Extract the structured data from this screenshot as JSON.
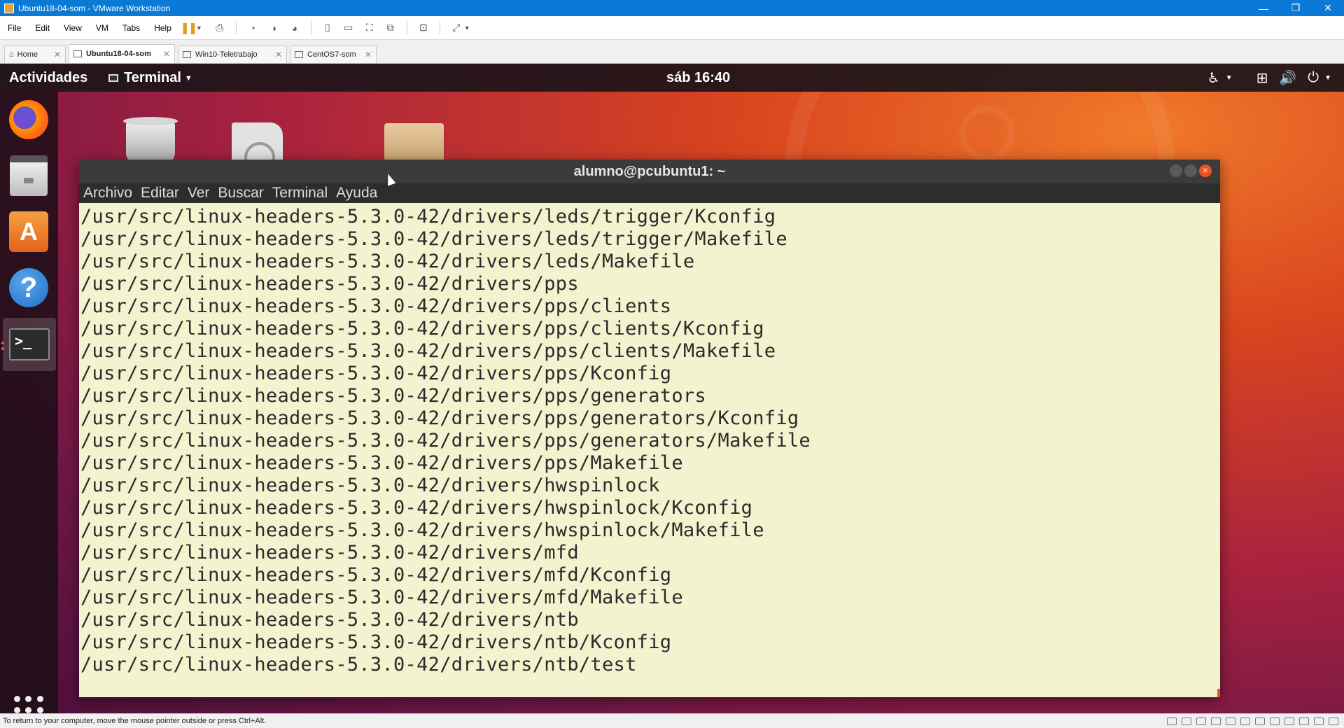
{
  "window": {
    "title": "Ubuntu18-04-som - VMware Workstation",
    "controls": {
      "minimize": "—",
      "restore": "❐",
      "close": "✕"
    }
  },
  "menubar": {
    "items": [
      "File",
      "Edit",
      "View",
      "VM",
      "Tabs",
      "Help"
    ]
  },
  "tabs": [
    {
      "label": "Home",
      "icon": "home-icon",
      "active": false
    },
    {
      "label": "Ubuntu18-04-som",
      "icon": "vm-icon",
      "active": true
    },
    {
      "label": "Win10-Teletrabajo",
      "icon": "vm-icon",
      "active": false
    },
    {
      "label": "CentOS7-som",
      "icon": "vm-icon",
      "active": false
    }
  ],
  "gnome": {
    "activities": "Actividades",
    "app_menu": "Terminal",
    "clock": "sáb 16:40"
  },
  "terminal": {
    "title": "alumno@pcubuntu1: ~",
    "menu": [
      "Archivo",
      "Editar",
      "Ver",
      "Buscar",
      "Terminal",
      "Ayuda"
    ],
    "lines": [
      "/usr/src/linux-headers-5.3.0-42/drivers/leds/trigger/Kconfig",
      "/usr/src/linux-headers-5.3.0-42/drivers/leds/trigger/Makefile",
      "/usr/src/linux-headers-5.3.0-42/drivers/leds/Makefile",
      "/usr/src/linux-headers-5.3.0-42/drivers/pps",
      "/usr/src/linux-headers-5.3.0-42/drivers/pps/clients",
      "/usr/src/linux-headers-5.3.0-42/drivers/pps/clients/Kconfig",
      "/usr/src/linux-headers-5.3.0-42/drivers/pps/clients/Makefile",
      "/usr/src/linux-headers-5.3.0-42/drivers/pps/Kconfig",
      "/usr/src/linux-headers-5.3.0-42/drivers/pps/generators",
      "/usr/src/linux-headers-5.3.0-42/drivers/pps/generators/Kconfig",
      "/usr/src/linux-headers-5.3.0-42/drivers/pps/generators/Makefile",
      "/usr/src/linux-headers-5.3.0-42/drivers/pps/Makefile",
      "/usr/src/linux-headers-5.3.0-42/drivers/hwspinlock",
      "/usr/src/linux-headers-5.3.0-42/drivers/hwspinlock/Kconfig",
      "/usr/src/linux-headers-5.3.0-42/drivers/hwspinlock/Makefile",
      "/usr/src/linux-headers-5.3.0-42/drivers/mfd",
      "/usr/src/linux-headers-5.3.0-42/drivers/mfd/Kconfig",
      "/usr/src/linux-headers-5.3.0-42/drivers/mfd/Makefile",
      "/usr/src/linux-headers-5.3.0-42/drivers/ntb",
      "/usr/src/linux-headers-5.3.0-42/drivers/ntb/Kconfig",
      "/usr/src/linux-headers-5.3.0-42/drivers/ntb/test"
    ]
  },
  "statusbar": {
    "hint": "To return to your computer, move the mouse pointer outside or press Ctrl+Alt."
  },
  "colors": {
    "vmware_titlebar": "#0a7ad6",
    "ubuntu_orange": "#e95420",
    "terminal_bg": "#f3f3d0",
    "terminal_fg": "#2b2b2b"
  }
}
